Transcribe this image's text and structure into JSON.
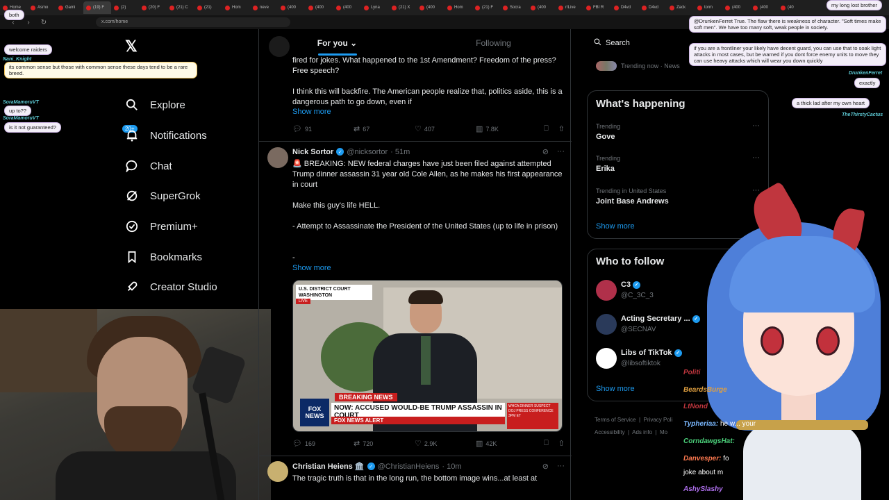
{
  "browser": {
    "tabs": [
      "Home",
      "Asmo",
      "Gami",
      "(19) F",
      "(2)",
      "(20) F",
      "(21) C",
      "(21)",
      "Hom",
      "neve",
      "(400",
      "(400",
      "(400",
      "Lyna",
      "(21) X",
      "(400",
      "Hom",
      "(21) F",
      "Socra",
      "(400",
      "r/Live",
      "FBI R",
      "D4vd",
      "D4vd",
      "Zack",
      "torm",
      "(400",
      "(400",
      "(40"
    ],
    "url": "x.com/home"
  },
  "nav": {
    "items": [
      {
        "label": "Explore",
        "icon": "search-icon"
      },
      {
        "label": "Notifications",
        "icon": "bell-icon"
      },
      {
        "label": "Chat",
        "icon": "chat-icon"
      },
      {
        "label": "SuperGrok",
        "icon": "grok-icon"
      },
      {
        "label": "Premium+",
        "icon": "premium-icon"
      },
      {
        "label": "Bookmarks",
        "icon": "bookmark-icon"
      },
      {
        "label": "Creator Studio",
        "icon": "rocket-icon"
      }
    ],
    "notif_badge": "20+"
  },
  "feed": {
    "tabs": [
      "For you",
      "Following"
    ],
    "tweet1": {
      "text": "fired for jokes. What happened to the 1st Amendment? Freedom of the press? Free speech?",
      "text2": "I think this will backfire. The American people realize that, politics aside, this is a dangerous path to go down, even if",
      "show_more": "Show more",
      "replies": "91",
      "reposts": "67",
      "likes": "407",
      "views": "7.8K"
    },
    "tweet2": {
      "name": "Nick Sortor",
      "handle": "@nicksortor",
      "time": "· 51m",
      "line1": "🚨 BREAKING: NEW federal charges have just been filed against attempted Trump dinner assassin 31 year old Cole Allen, as he makes his first appearance in court",
      "line2": "Make this guy's life HELL.",
      "line3": "- Attempt to Assassinate the President of the United States (up to life in prison)",
      "line4": "-",
      "show_more": "Show more",
      "replies": "169",
      "reposts": "720",
      "likes": "2.9K",
      "views": "42K",
      "media": {
        "court_label": "U.S. DISTRICT COURT WASHINGTON",
        "live": "LIVE",
        "breaking": "BREAKING NEWS",
        "headline": "NOW: ACCUSED WOULD-BE TRUMP ASSASSIN IN COURT",
        "alert": "FOX NEWS ALERT",
        "fox": "FOX NEWS",
        "side": "WHCA DINNER SUSPECT DOJ PRESS CONFERENCE 3PM ET"
      }
    },
    "tweet3": {
      "name": "Christian Heiens 🏛️",
      "handle": "@ChristianHeiens",
      "time": "· 10m",
      "text": "The tragic truth is that in the long run, the bottom image wins...at least at"
    }
  },
  "right": {
    "search_placeholder": "Search",
    "trending_now": "Trending now · News",
    "whats_happening": "What's happening",
    "trends": [
      {
        "meta": "Trending",
        "name": "Gove"
      },
      {
        "meta": "Trending",
        "name": "Erika"
      },
      {
        "meta": "Trending in United States",
        "name": "Joint Base Andrews"
      }
    ],
    "show_more": "Show more",
    "who_to_follow": "Who to follow",
    "follow": [
      {
        "name": "C3",
        "handle": "@C_3C_3"
      },
      {
        "name": "Acting Secretary ...",
        "handle": "@SECNAV"
      },
      {
        "name": "Libs of TikTok",
        "handle": "@libsoftiktok"
      }
    ],
    "footer": [
      "Terms of Service",
      "Privacy Poli",
      "Accessibility",
      "Ads info",
      "Mo"
    ]
  },
  "overlay_chat": {
    "left": [
      {
        "user": "",
        "msg": "both"
      },
      {
        "user": "",
        "msg": "welcome raiders"
      },
      {
        "user": "Nani_Knight",
        "msg": "its common sense but those with common sense these days tend to be a rare breed."
      },
      {
        "user": "SoraMamoruVT",
        "msg": "up to??"
      },
      {
        "user": "SoraMamoruVT",
        "msg": "is it not guaranteed?"
      }
    ],
    "right": [
      {
        "msg": "my long lost brother"
      },
      {
        "msg": "@DrunkenFerret True. The flaw there is weakness of character. \"Soft times make soft men\". We have too many soft, weak people in society."
      },
      {
        "msg": "if you are a frontliner your likely have decent guard, you can use that to soak light attacks in most cases, but be warned if you dont force enemy units to move they can use heavy attacks which will wear you down quickly"
      },
      {
        "user": "DrunkenFerret",
        "msg": "exactly"
      },
      {
        "msg": "a thick lad after my own heart"
      },
      {
        "user": "TheThirstyCactus",
        "msg": ""
      }
    ],
    "side": [
      {
        "user": "Politi",
        "msg": "",
        "color": "#c0363e"
      },
      {
        "user": "BeardsBurge",
        "msg": "",
        "color": "#e0a040"
      },
      {
        "user": "LtNond",
        "msg": "",
        "color": "#c0363e"
      },
      {
        "user": "Typheriaa:",
        "msg": "he w... your",
        "color": "#7ab8ff"
      },
      {
        "user": "CorndawgsHat:",
        "msg": "",
        "color": "#4bd07a"
      },
      {
        "user": "Danvesper:",
        "msg": "fo",
        "color": "#ff7a50"
      },
      {
        "user": "",
        "msg": "joke about m",
        "color": "#fff"
      },
      {
        "user": "AshySlashy",
        "msg": "",
        "color": "#b070f0"
      }
    ]
  }
}
